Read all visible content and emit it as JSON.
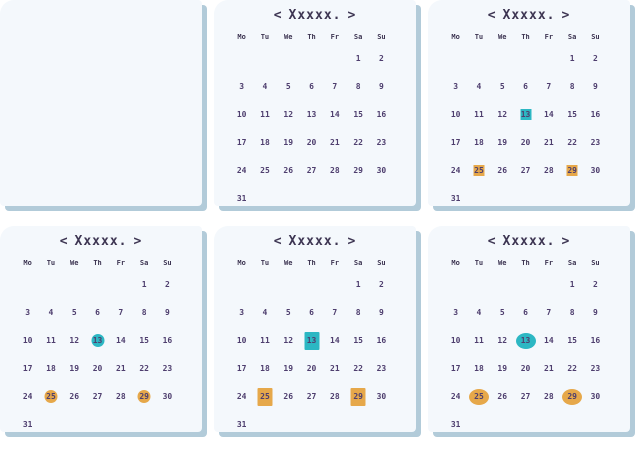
{
  "header": {
    "prev": "<",
    "month": "Xxxxx.",
    "next": ">"
  },
  "weekdays": [
    "Mo",
    "Tu",
    "We",
    "Th",
    "Fr",
    "Sa",
    "Su"
  ],
  "weeks": [
    [
      "",
      "",
      "",
      "",
      "",
      "1",
      "2"
    ],
    [
      "3",
      "4",
      "5",
      "6",
      "7",
      "8",
      "9"
    ],
    [
      "10",
      "11",
      "12",
      "13",
      "14",
      "15",
      "16"
    ],
    [
      "17",
      "18",
      "19",
      "20",
      "21",
      "22",
      "23"
    ],
    [
      "24",
      "25",
      "26",
      "27",
      "28",
      "29",
      "30"
    ],
    [
      "31",
      "",
      "",
      "",
      "",
      "",
      ""
    ]
  ],
  "colors": {
    "panel_bg": "#f4f8fc",
    "shadow": "#b2cbd9",
    "text": "#3d3552",
    "teal_highlight": "#2cb7c3",
    "gold_highlight": "#e6a84a"
  },
  "panels": [
    {
      "id": "blank",
      "blank": true
    },
    {
      "id": "plain",
      "blank": false,
      "highlight_shape": "none",
      "teal": [],
      "gold": []
    },
    {
      "id": "square",
      "blank": false,
      "highlight_shape": "square",
      "teal": [
        "13"
      ],
      "gold": [
        "25",
        "29"
      ]
    },
    {
      "id": "circle",
      "blank": false,
      "highlight_shape": "circle",
      "teal": [
        "13"
      ],
      "gold": [
        "25",
        "29"
      ]
    },
    {
      "id": "box",
      "blank": false,
      "highlight_shape": "box",
      "teal": [
        "13"
      ],
      "gold": [
        "25",
        "29"
      ]
    },
    {
      "id": "blob",
      "blank": false,
      "highlight_shape": "blob",
      "teal": [
        "13"
      ],
      "gold": [
        "25",
        "29"
      ]
    }
  ]
}
